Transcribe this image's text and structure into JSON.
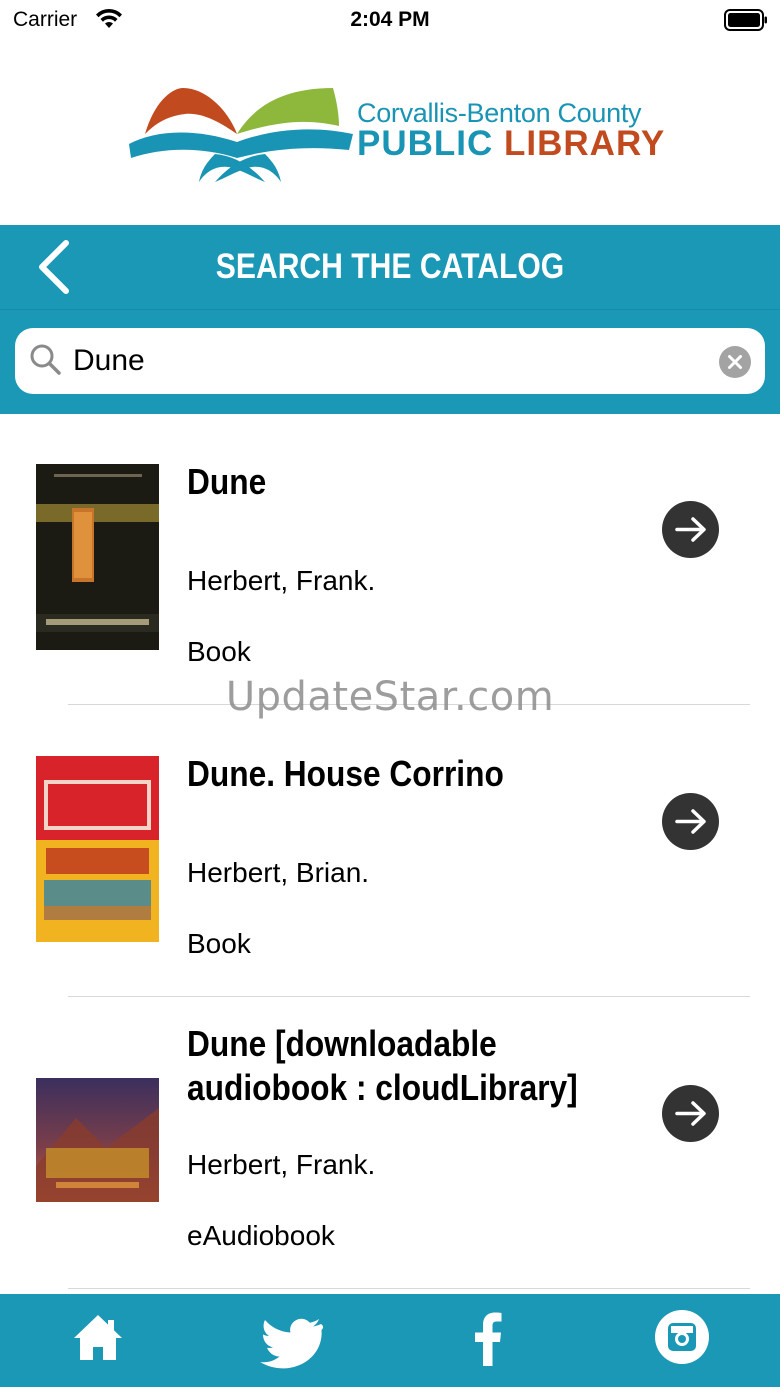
{
  "status_bar": {
    "carrier": "Carrier",
    "time": "2:04 PM"
  },
  "logo": {
    "line1": "Corvallis-Benton County",
    "line2_public": "PUBLIC",
    "line2_library": "LIBRARY"
  },
  "header": {
    "title": "SEARCH THE CATALOG",
    "back_icon": "chevron-left-icon"
  },
  "search": {
    "value": "Dune",
    "placeholder": ""
  },
  "results": [
    {
      "title": "Dune",
      "author": "Herbert, Frank.",
      "format": "Book"
    },
    {
      "title": "Dune. House Corrino",
      "author": "Herbert, Brian.",
      "format": "Book"
    },
    {
      "title_lines": [
        "Dune [downloadable",
        "audiobook : cloudLibrary]"
      ],
      "author": "Herbert, Frank.",
      "format": "eAudiobook"
    }
  ],
  "watermark": "UpdateStar.com",
  "tab_bar": {
    "items": [
      "home-icon",
      "twitter-icon",
      "facebook-icon",
      "instagram-icon"
    ]
  },
  "colors": {
    "brand": "#1a98b6",
    "accent": "#c14a1e",
    "button": "#333333"
  }
}
